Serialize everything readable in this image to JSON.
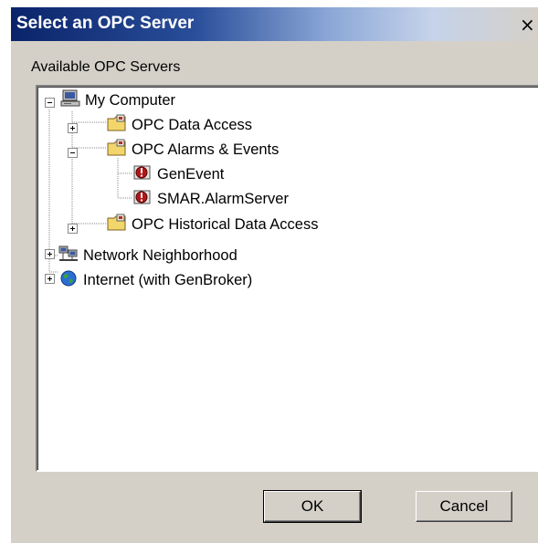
{
  "window": {
    "title": "Select an OPC Server",
    "close_glyph": "×"
  },
  "group_label": "Available OPC Servers",
  "tree": {
    "my_computer": {
      "label": "My Computer",
      "icon": "computer-icon",
      "expanded": true
    },
    "opc_data_access": {
      "label": "OPC Data Access",
      "icon": "folder-icon",
      "expanded": false
    },
    "opc_alarms_events": {
      "label": "OPC Alarms & Events",
      "icon": "folder-icon",
      "expanded": true
    },
    "genevent": {
      "label": "GenEvent",
      "icon": "alarm-server-icon"
    },
    "smar_alarmserver": {
      "label": "SMAR.AlarmServer",
      "icon": "alarm-server-icon"
    },
    "opc_historical": {
      "label": "OPC Historical Data Access",
      "icon": "folder-icon",
      "expanded": false
    },
    "network_neighborhood": {
      "label": "Network Neighborhood",
      "icon": "network-icon",
      "expanded": false
    },
    "internet": {
      "label": "Internet (with GenBroker)",
      "icon": "globe-icon",
      "expanded": false
    }
  },
  "buttons": {
    "ok": "OK",
    "cancel": "Cancel"
  },
  "colors": {
    "titlebar_start": "#0a246a",
    "dialog_bg": "#d4d0c8"
  }
}
